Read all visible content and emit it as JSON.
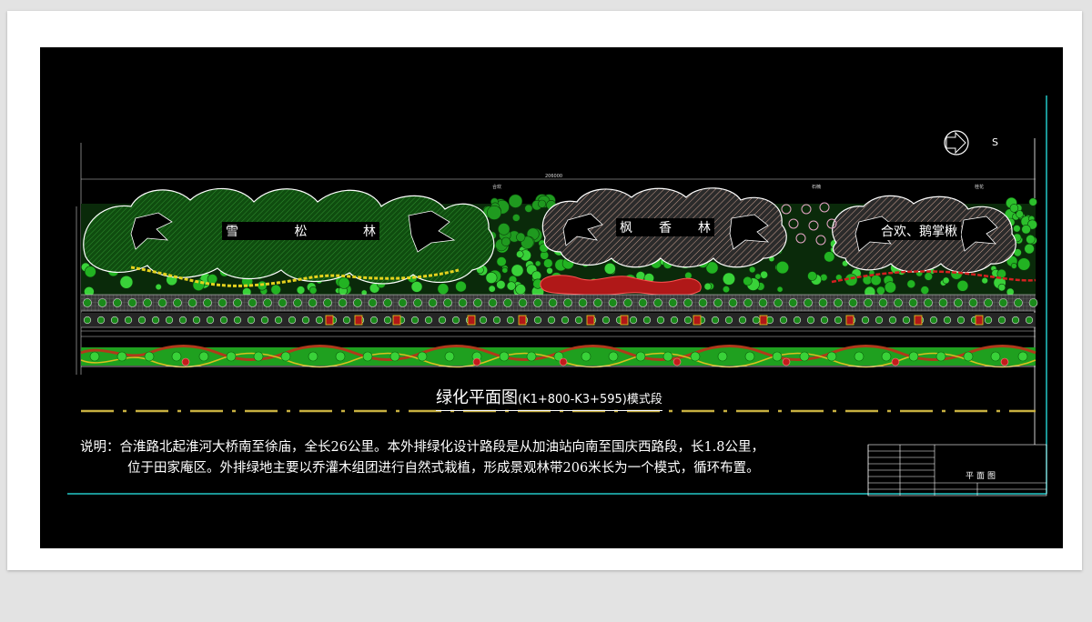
{
  "drawing": {
    "title_main": "绿化平面图",
    "title_sub": "(K1+800-K3+595)模式段",
    "note_line1": "说明：合淮路北起淮河大桥南至徐庙，全长26公里。本外排绿化设计路段是从加油站向南至国庆西路段，长1.8公里，",
    "note_line2": "位于田家庵区。外排绿地主要以乔灌木组团进行自然式栽植，形成景观林带206米长为一个模式，循环布置。",
    "forest_labels": {
      "pine": [
        "雪",
        "松",
        "林"
      ],
      "maple": [
        "枫",
        "香",
        "林"
      ],
      "albizia": "合欢、鹅掌楸"
    },
    "north_label": "S",
    "dimension_total": "206000",
    "plant_tags": [
      "合欢",
      "石楠",
      "桂花"
    ],
    "title_block_name": "平面图"
  },
  "colors": {
    "canvas": "#000000",
    "tree_fill": "#1a6e1a",
    "tree_outline": "#ffffff",
    "grass": "#21c21c",
    "shrub_red": "#b01818",
    "path_yellow": "#e6d21e",
    "cad_cyan": "#22c8c8",
    "maple_hatch": "#c89e8e"
  }
}
